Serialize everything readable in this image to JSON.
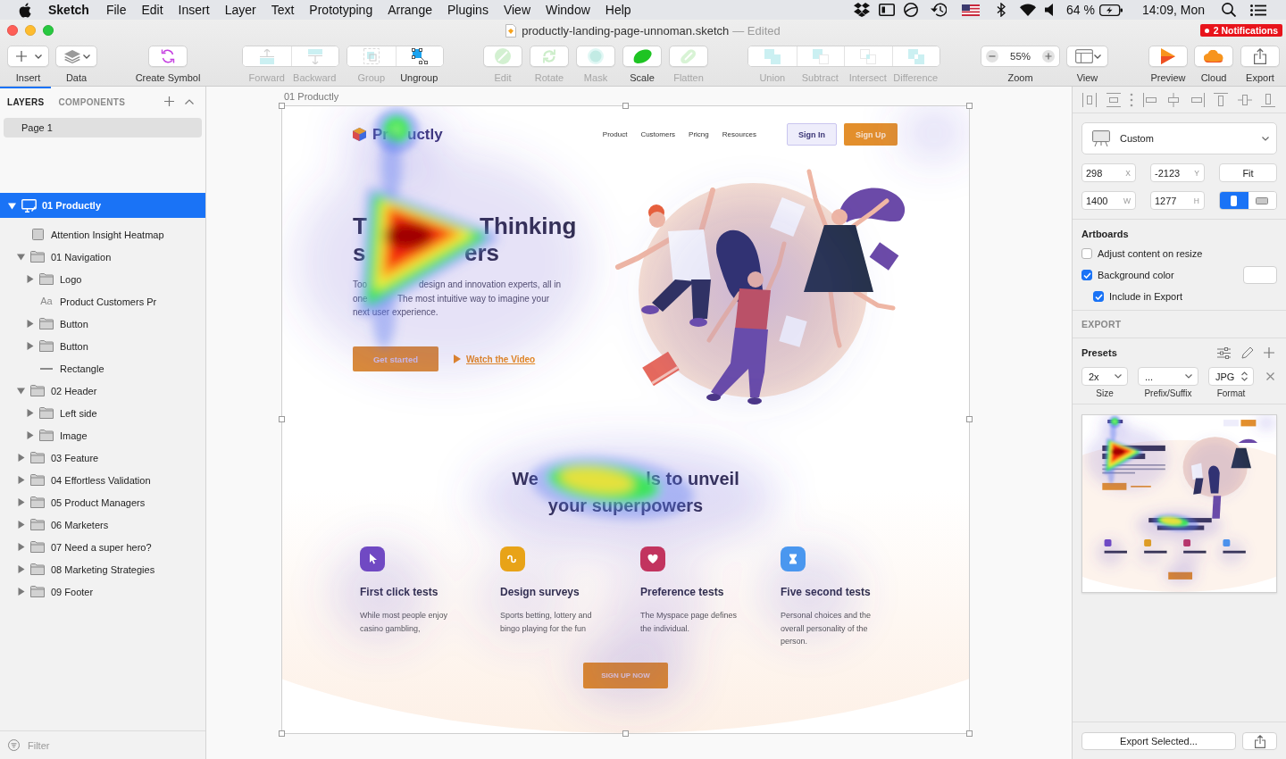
{
  "menu_bar": {
    "app": "Sketch",
    "menus": [
      "File",
      "Edit",
      "Insert",
      "Layer",
      "Text",
      "Prototyping",
      "Arrange",
      "Plugins",
      "View",
      "Window",
      "Help"
    ],
    "battery": "64 %",
    "clock": "14:09, Mon"
  },
  "window": {
    "title": "productly-landing-page-unnoman.sketch",
    "status": "— Edited",
    "notifications": "2 Notifications"
  },
  "toolbar": [
    {
      "kind": "dropdown",
      "items": [
        {
          "label": "Insert",
          "disabled": false
        }
      ]
    },
    {
      "kind": "dropdown",
      "items": [
        {
          "label": "Data",
          "disabled": false
        }
      ]
    },
    {
      "kind": "button",
      "items": [
        {
          "label": "Create Symbol",
          "disabled": false
        }
      ]
    },
    {
      "kind": "segmented",
      "items": [
        {
          "label": "Forward",
          "disabled": true
        },
        {
          "label": "Backward",
          "disabled": true
        }
      ]
    },
    {
      "kind": "segmented",
      "items": [
        {
          "label": "Group",
          "disabled": true
        },
        {
          "label": "Ungroup",
          "disabled": false
        }
      ]
    },
    {
      "kind": "button",
      "items": [
        {
          "label": "Edit",
          "disabled": true
        }
      ]
    },
    {
      "kind": "button",
      "items": [
        {
          "label": "Rotate",
          "disabled": true
        }
      ]
    },
    {
      "kind": "button",
      "items": [
        {
          "label": "Mask",
          "disabled": true
        }
      ]
    },
    {
      "kind": "button",
      "items": [
        {
          "label": "Scale",
          "disabled": false
        }
      ]
    },
    {
      "kind": "button",
      "items": [
        {
          "label": "Flatten",
          "disabled": true
        }
      ]
    },
    {
      "kind": "segmented",
      "items": [
        {
          "label": "Union",
          "disabled": true
        },
        {
          "label": "Subtract",
          "disabled": true
        },
        {
          "label": "Intersect",
          "disabled": true
        },
        {
          "label": "Difference",
          "disabled": true
        }
      ]
    },
    {
      "kind": "zoom",
      "value": "55%",
      "items": [
        {
          "label": "Zoom",
          "disabled": false
        }
      ]
    },
    {
      "kind": "dropdown",
      "items": [
        {
          "label": "View",
          "disabled": false
        }
      ]
    },
    {
      "kind": "button",
      "items": [
        {
          "label": "Preview",
          "disabled": false
        }
      ]
    },
    {
      "kind": "button",
      "items": [
        {
          "label": "Cloud",
          "disabled": false
        }
      ]
    },
    {
      "kind": "button",
      "items": [
        {
          "label": "Export",
          "disabled": false
        }
      ]
    }
  ],
  "sidebar": {
    "tabs": [
      {
        "label": "LAYERS",
        "selected": true
      },
      {
        "label": "COMPONENTS",
        "selected": false
      }
    ],
    "pages": [
      {
        "label": "Page 1",
        "selected": true
      }
    ],
    "layers": [
      {
        "label": "01 Productly",
        "kind": "artboard",
        "expanded": true,
        "selected": true,
        "children": [
          {
            "label": "Attention Insight Heatmap",
            "kind": "image",
            "selected": false
          },
          {
            "label": "01 Navigation",
            "kind": "group",
            "expanded": true,
            "selected": false,
            "children": [
              {
                "label": "Logo",
                "kind": "group",
                "expanded": false,
                "selected": false
              },
              {
                "label": "Product Customers Pr",
                "kind": "text",
                "glyph": "Aa",
                "selected": false
              },
              {
                "label": "Button",
                "kind": "group",
                "expanded": false,
                "selected": false
              },
              {
                "label": "Button",
                "kind": "group",
                "expanded": false,
                "selected": false
              },
              {
                "label": "Rectangle",
                "kind": "line",
                "selected": false
              }
            ]
          },
          {
            "label": "02 Header",
            "kind": "group",
            "expanded": true,
            "selected": false,
            "children": [
              {
                "label": "Left side",
                "kind": "group",
                "expanded": false,
                "selected": false
              },
              {
                "label": "Image",
                "kind": "group",
                "expanded": false,
                "selected": false
              }
            ]
          },
          {
            "label": "03 Feature",
            "kind": "group",
            "expanded": false,
            "selected": false
          },
          {
            "label": "04 Effortless Validation",
            "kind": "group",
            "expanded": false,
            "selected": false
          },
          {
            "label": "05 Product Managers",
            "kind": "group",
            "expanded": false,
            "selected": false
          },
          {
            "label": "06 Marketers",
            "kind": "group",
            "expanded": false,
            "selected": false
          },
          {
            "label": "07 Need a super hero?",
            "kind": "group",
            "expanded": false,
            "selected": false
          },
          {
            "label": "08 Marketing Strategies",
            "kind": "group",
            "expanded": false,
            "selected": false
          },
          {
            "label": "09 Footer",
            "kind": "group",
            "expanded": false,
            "selected": false
          }
        ]
      }
    ],
    "filter": {
      "placeholder": "Filter"
    }
  },
  "canvas": {
    "artboard_label": "01 Productly",
    "artboard": {
      "nav": {
        "logo_parts": [
          "Pr",
          "uctly"
        ],
        "links": [
          "Product",
          "Customers",
          "Pricng",
          "Resources"
        ],
        "sign_in": "Sign In",
        "sign_up": "Sign Up"
      },
      "hero": {
        "heading_lines": [
          [
            "T",
            "Thinking"
          ],
          [
            "s",
            "ers"
          ]
        ],
        "paragraph_lines": [
          [
            "Too",
            "design and innovation experts, all in"
          ],
          [
            "one",
            "The most intuitive way to imagine your"
          ],
          [
            "next user experience."
          ]
        ],
        "cta": "Get started",
        "video_link": "Watch the Video"
      },
      "features": {
        "heading_lines": [
          [
            "We",
            "ls to unveil"
          ],
          [
            "your superpowers"
          ]
        ],
        "items": [
          {
            "title": "First click tests",
            "text": "While most people enjoy casino gambling,",
            "color": "#7049c3"
          },
          {
            "title": "Design surveys",
            "text": "Sports betting, lottery and bingo playing for the fun",
            "color": "#e8a318"
          },
          {
            "title": "Preference tests",
            "text": "The Myspace page defines the individual.",
            "color": "#c2345f"
          },
          {
            "title": "Five second tests",
            "text": "Personal choices and the overall personality of the person.",
            "color": "#4a97ef"
          }
        ],
        "cta": "SIGN UP NOW"
      }
    }
  },
  "inspector": {
    "preset": "Custom",
    "fields": [
      {
        "value": "298",
        "unit": "X"
      },
      {
        "value": "-2123",
        "unit": "Y"
      },
      {
        "value": "1400",
        "unit": "W"
      },
      {
        "value": "1277",
        "unit": "H"
      }
    ],
    "fit": "Fit",
    "orientation": [
      {
        "selected": true
      },
      {
        "selected": false
      }
    ],
    "artboards_title": "Artboards",
    "options": [
      {
        "label": "Adjust content on resize",
        "checked": false
      },
      {
        "label": "Background color",
        "checked": true,
        "color": "#ffffff",
        "children": [
          {
            "label": "Include in Export",
            "checked": true
          }
        ]
      }
    ],
    "export_title": "EXPORT",
    "presets_title": "Presets",
    "export_fields": [
      {
        "kind": "select",
        "value": "2x",
        "caption": "Size"
      },
      {
        "kind": "select",
        "value": "...",
        "caption": "Prefix/Suffix"
      },
      {
        "kind": "stepper",
        "value": "JPG",
        "caption": "Format"
      }
    ],
    "export_button": "Export Selected..."
  }
}
